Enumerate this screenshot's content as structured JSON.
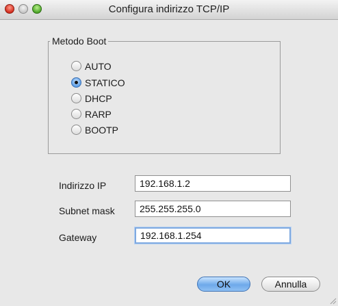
{
  "window": {
    "title": "Configura indirizzo TCP/IP",
    "controls": [
      "close",
      "minimize",
      "zoom"
    ]
  },
  "boot_method": {
    "label": "Metodo Boot",
    "options": [
      "AUTO",
      "STATICO",
      "DHCP",
      "RARP",
      "BOOTP"
    ],
    "selected": "STATICO"
  },
  "fields": {
    "ip_label": "Indirizzo IP",
    "ip_value": "192.168.1.2",
    "subnet_label": "Subnet mask",
    "subnet_value": "255.255.255.0",
    "gateway_label": "Gateway",
    "gateway_value": "192.168.1.254"
  },
  "buttons": {
    "ok": "OK",
    "cancel": "Annulla"
  },
  "colors": {
    "accent": "#6ea9ea",
    "close": "#d42c1d",
    "zoom": "#4ea62a"
  }
}
